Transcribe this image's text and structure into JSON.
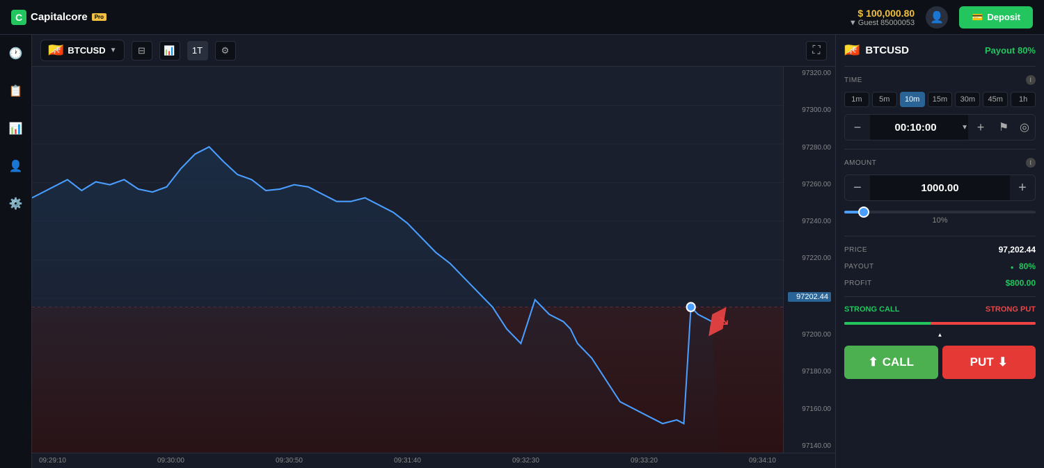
{
  "header": {
    "logo_text": "Capitalcore",
    "logo_pro": "Pro",
    "balance": "$ 100,000.80",
    "balance_arrow": "▼",
    "guest": "Guest 85000053",
    "deposit_label": "Deposit",
    "deposit_icon": "💳"
  },
  "sidebar": {
    "icons": [
      "🕐",
      "📋",
      "📊",
      "👤",
      "⚙️"
    ]
  },
  "chart_toolbar": {
    "symbol": "BTCUSD",
    "symbol_dropdown": "▼",
    "chart_type_icon": "⊟",
    "bar_chart_icon": "📊",
    "timeframe": "1T",
    "settings_icon": "⚙",
    "expand_icon": "⛶"
  },
  "chart": {
    "y_labels": [
      "97320.00",
      "97300.00",
      "97280.00",
      "97260.00",
      "97240.00",
      "97220.00",
      "97202.44",
      "97200.00",
      "97180.00",
      "97160.00",
      "97140.00"
    ],
    "current_price": "97202.44",
    "x_labels": [
      "09:29:10",
      "09:30:00",
      "09:30:50",
      "09:31:40",
      "09:32:30",
      "09:33:20",
      "09:34:10"
    ]
  },
  "right_panel": {
    "symbol": "BTCUSD",
    "payout_label": "Payout 80%",
    "time_section": "TIME",
    "time_options": [
      "1m",
      "5m",
      "10m",
      "15m",
      "30m",
      "45m",
      "1h"
    ],
    "active_time": "10m",
    "time_value": "00:10:00",
    "amount_section": "AMOUNT",
    "amount_value": "1000.00",
    "slider_pct": "10%",
    "price_label": "PRICE",
    "price_value": "97,202.44",
    "payout_row_label": "PAYOUT",
    "payout_row_value": "80%",
    "profit_label": "PROFIT",
    "profit_value": "$800.00",
    "strong_call": "STRONG CALL",
    "strong_put": "STRONG PUT",
    "call_label": "CALL",
    "put_label": "PUT",
    "call_icon": "⬆",
    "put_icon": "⬇"
  }
}
